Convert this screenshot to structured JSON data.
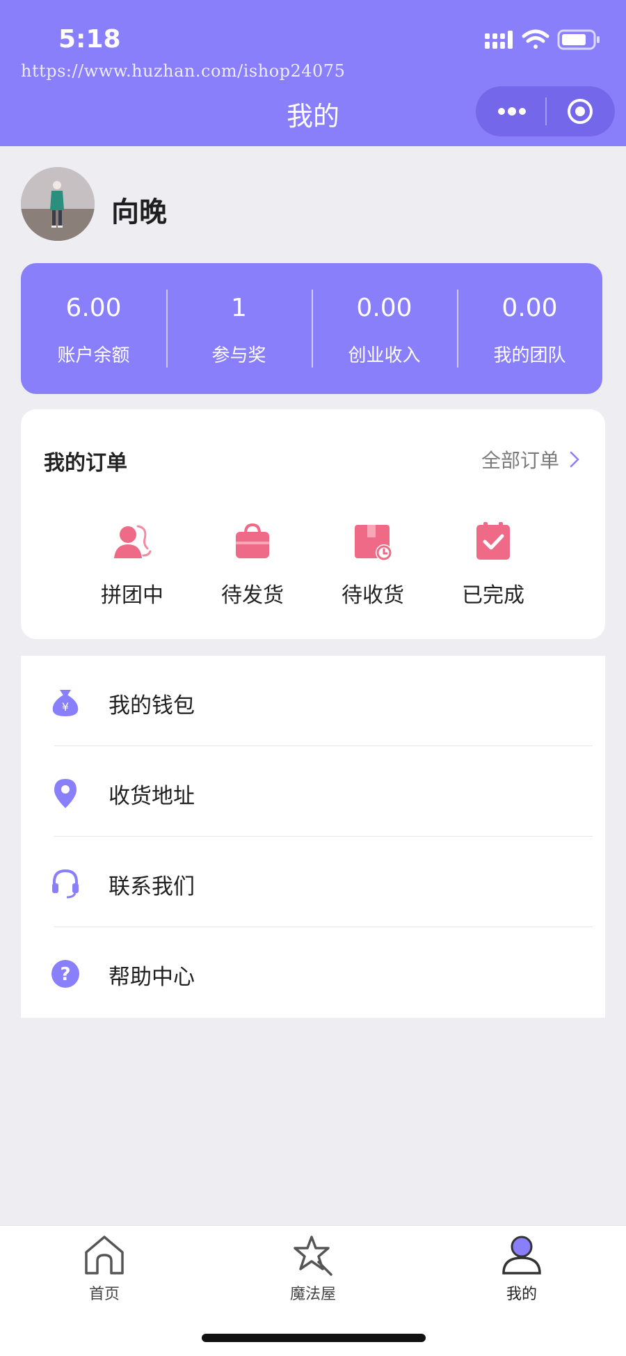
{
  "status_bar": {
    "time": "5:18",
    "watermark": "https://www.huzhan.com/ishop24075"
  },
  "nav": {
    "title": "我的"
  },
  "profile": {
    "name": "向晚"
  },
  "stats": [
    {
      "value": "6.00",
      "label": "账户余额"
    },
    {
      "value": "1",
      "label": "参与奖"
    },
    {
      "value": "0.00",
      "label": "创业收入"
    },
    {
      "value": "0.00",
      "label": "我的团队"
    }
  ],
  "orders": {
    "title": "我的订单",
    "all_label": "全部订单",
    "items": [
      {
        "label": "拼团中",
        "icon": "group-buying-icon"
      },
      {
        "label": "待发货",
        "icon": "shopping-bag-icon"
      },
      {
        "label": "待收货",
        "icon": "package-clock-icon"
      },
      {
        "label": "已完成",
        "icon": "clipboard-check-icon"
      }
    ]
  },
  "menu": [
    {
      "label": "我的钱包",
      "icon": "money-bag-icon"
    },
    {
      "label": "收货地址",
      "icon": "location-pin-icon"
    },
    {
      "label": "联系我们",
      "icon": "headset-icon"
    },
    {
      "label": "帮助中心",
      "icon": "help-icon"
    }
  ],
  "tabbar": [
    {
      "label": "首页",
      "icon": "home-icon"
    },
    {
      "label": "魔法屋",
      "icon": "magic-star-icon"
    },
    {
      "label": "我的",
      "icon": "user-icon",
      "active": true
    }
  ],
  "colors": {
    "primary": "#8a7ffb",
    "order_icon": "#ee6a86",
    "background": "#ededf2"
  }
}
